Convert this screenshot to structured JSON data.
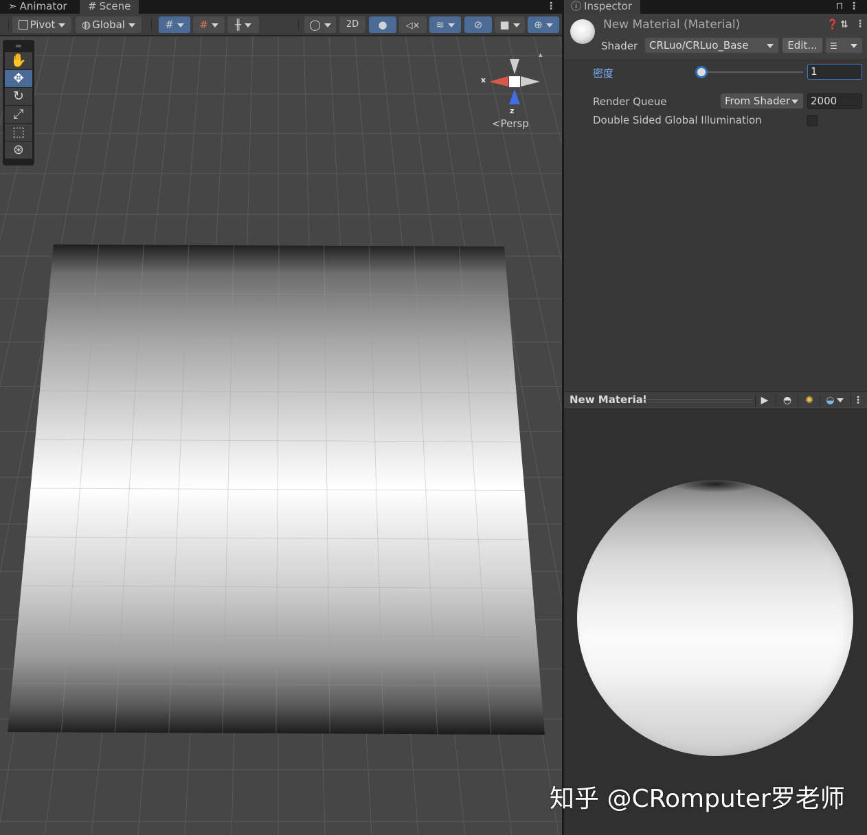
{
  "left_tabs": {
    "animator": "Animator",
    "scene": "Scene"
  },
  "scene_toolbar": {
    "pivot": "Pivot",
    "global": "Global",
    "mode_2d": "2D"
  },
  "viewport": {
    "persp_label": "Persp",
    "gizmo_x": "x",
    "gizmo_z": "z"
  },
  "inspector": {
    "tab": "Inspector",
    "material_title": "New Material (Material)",
    "shader_label": "Shader",
    "shader_value": "CRLuo/CRLuo_Base",
    "edit_button": "Edit...",
    "properties": {
      "density_label": "密度",
      "density_value": "1",
      "density_slider_fraction": 0.0,
      "render_queue_label": "Render Queue",
      "render_queue_mode": "From Shader",
      "render_queue_value": "2000",
      "double_sided_gi_label": "Double Sided Global Illumination",
      "double_sided_gi_checked": false
    },
    "preview": {
      "title": "New Material"
    }
  },
  "watermark": "知乎 @CRomputer罗老师",
  "colors": {
    "accent_blue": "#4a6b95",
    "highlight_label": "#7fb2ff",
    "panel": "#383838"
  }
}
